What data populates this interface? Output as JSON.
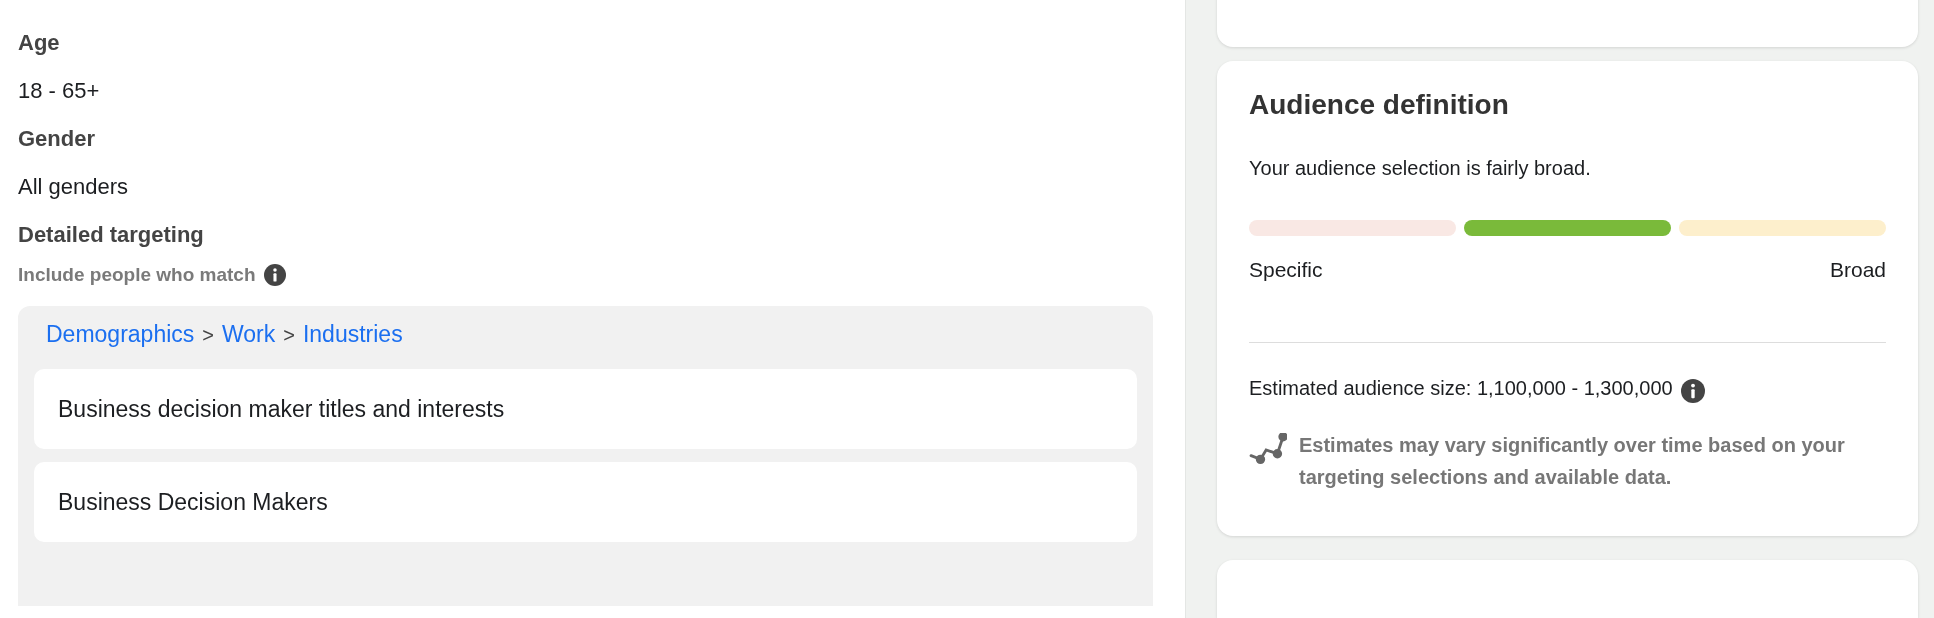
{
  "targeting": {
    "fields": [
      {
        "label": "Age",
        "value": "18 - 65+"
      },
      {
        "label": "Gender",
        "value": "All genders"
      }
    ],
    "detailed": {
      "label": "Detailed targeting",
      "hint": "Include people who match",
      "breadcrumb": [
        "Demographics",
        "Work",
        "Industries"
      ],
      "separator": ">",
      "items": [
        "Business decision maker titles and interests",
        "Business Decision Makers"
      ]
    }
  },
  "audience": {
    "title": "Audience definition",
    "summary": "Your audience selection is fairly broad.",
    "segments": [
      {
        "kind": "specific",
        "selected": false
      },
      {
        "kind": "moderate",
        "selected": true
      },
      {
        "kind": "broad",
        "selected": false
      }
    ],
    "scale_min": "Specific",
    "scale_max": "Broad",
    "estimate": "Estimated audience size: 1,100,000 - 1,300,000",
    "note": "Estimates may vary significantly over time based on your targeting selections and available data."
  }
}
